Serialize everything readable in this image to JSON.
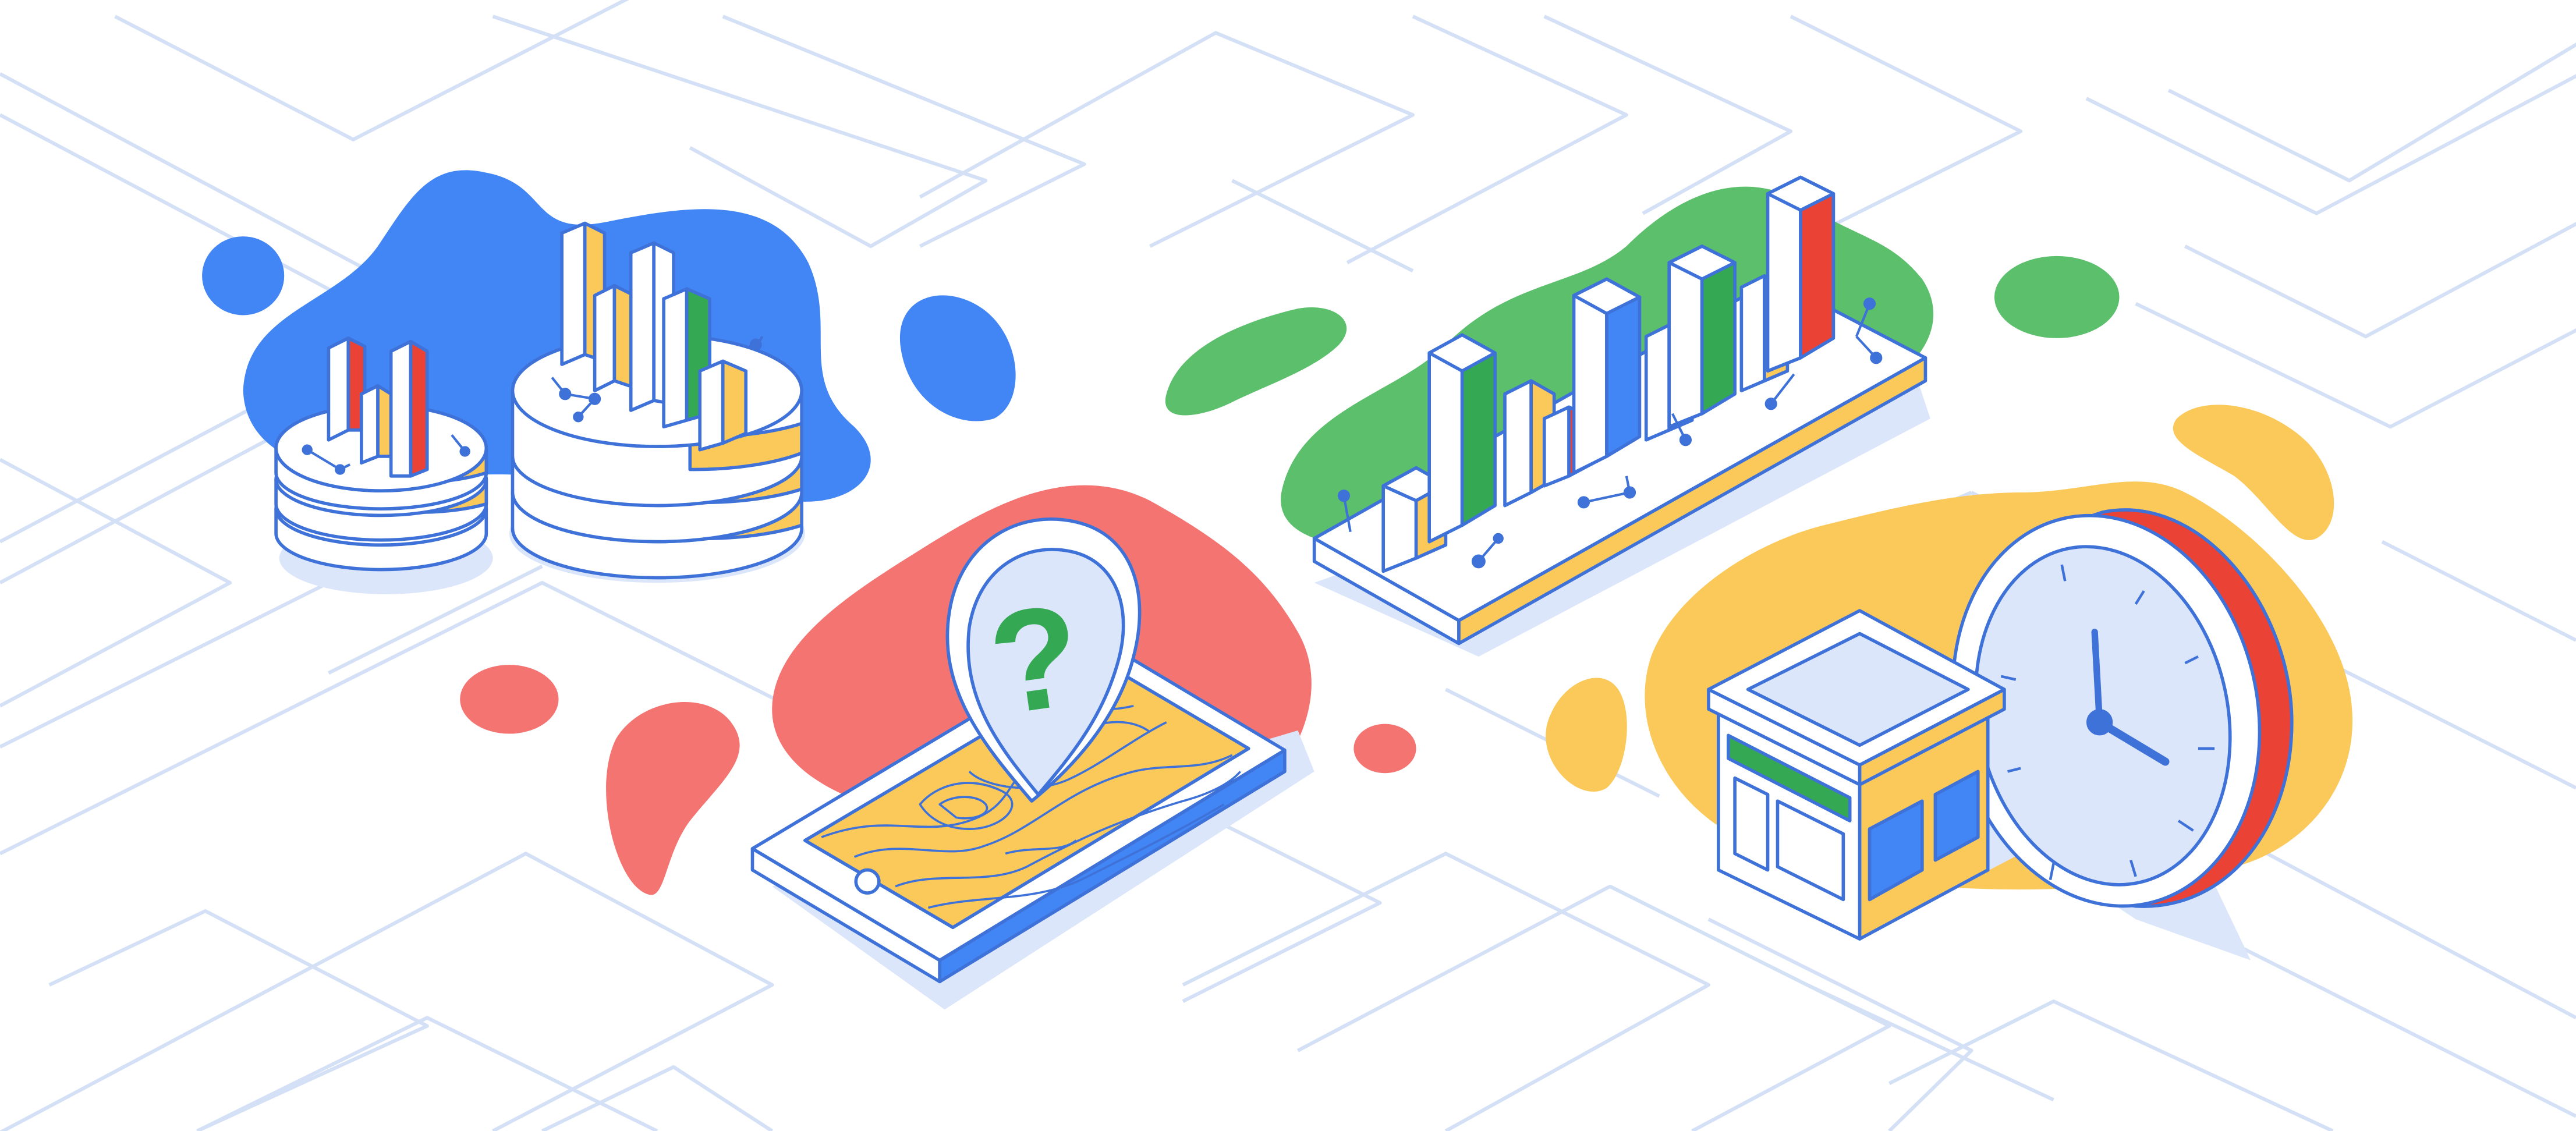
{
  "image": {
    "kind": "isometric illustration banner",
    "background": "#ffffff"
  },
  "colors": {
    "blue": "#4285F4",
    "green": "#5BBF6C",
    "green_dark": "#34A853",
    "red": "#F47472",
    "red_solid": "#EA4335",
    "yellow": "#FBC95A",
    "yellow_bar": "#FBC02D",
    "outline": "#3E72D8",
    "shadow": "#DCE6FB",
    "map_line": "#D4E0F5",
    "clock_face": "#DCE6FB"
  },
  "clusters": [
    {
      "name": "stacked-coins-with-bar-charts",
      "blob_color": "blue"
    },
    {
      "name": "phone-with-topographic-map-and-question-pin",
      "blob_color": "red",
      "pin_glyph": "?"
    },
    {
      "name": "isometric-bar-chart-platform",
      "blob_color": "green"
    },
    {
      "name": "storefront-and-wall-clock",
      "blob_color": "yellow",
      "clock_time": "4:00"
    }
  ]
}
